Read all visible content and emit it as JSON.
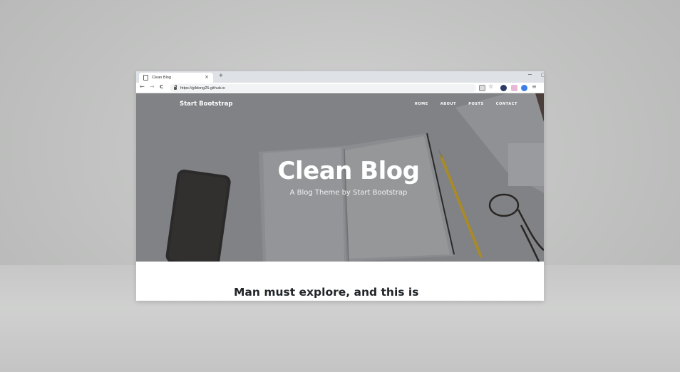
{
  "browser": {
    "tab_title": "Clean Blog",
    "tab_close": "×",
    "new_tab": "+",
    "minimize": "−",
    "url": "https://gildong25.github.io",
    "back": "←",
    "forward": "→",
    "reload": "C",
    "star": "☆"
  },
  "site": {
    "brand": "Start Bootstrap",
    "nav": [
      "HOME",
      "ABOUT",
      "POSTS",
      "CONTACT"
    ],
    "hero_title": "Clean Blog",
    "hero_subtitle": "A Blog Theme by Start Bootstrap",
    "post_title": "Man must explore, and this is"
  },
  "colors": {
    "hero_overlay": "#7b7d80",
    "text_dark": "#212529"
  }
}
